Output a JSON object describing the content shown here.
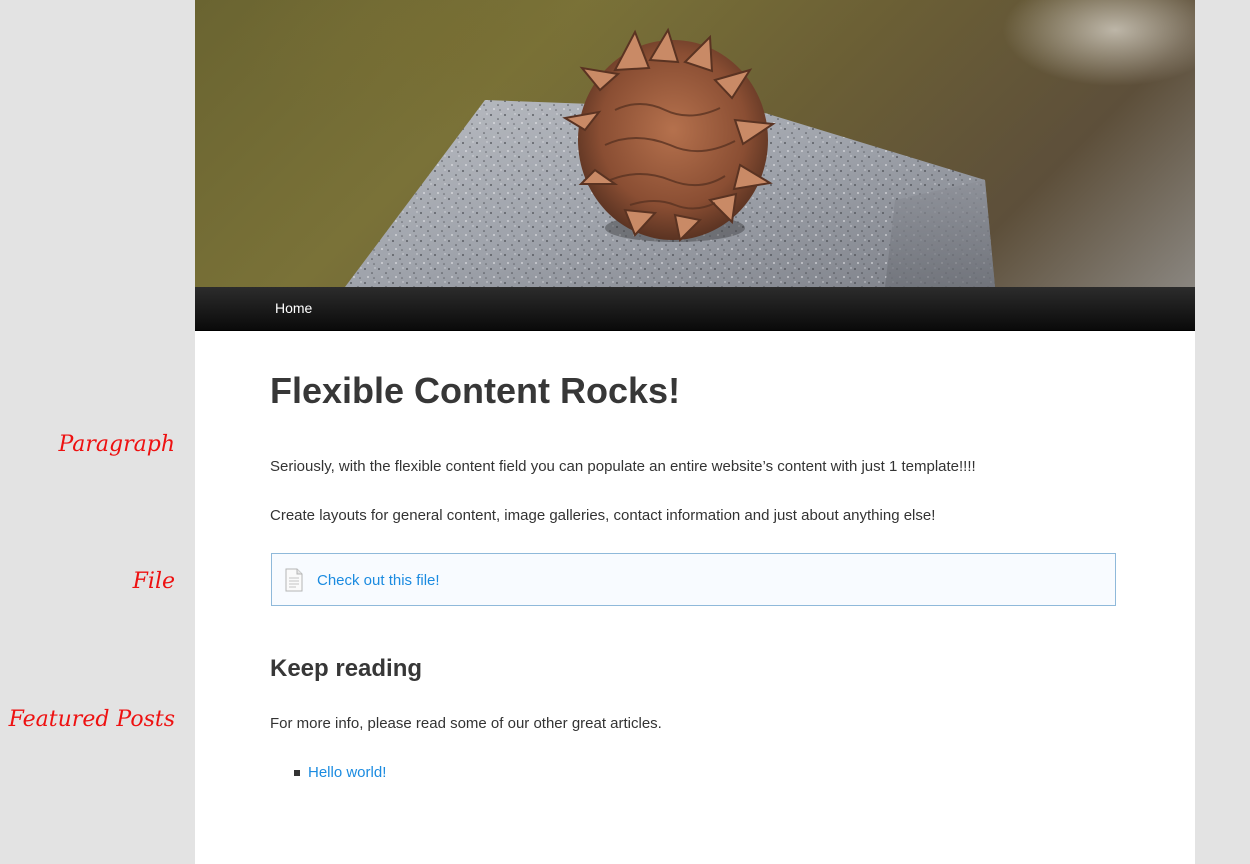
{
  "nav": {
    "home_label": "Home"
  },
  "main": {
    "title": "Flexible Content Rocks!",
    "paragraph_1": "Seriously, with the flexible content field you can populate an entire website’s content with just 1 template!!!!",
    "paragraph_2": "Create layouts for general content, image galleries, contact information and just about anything else!",
    "file": {
      "icon": "document-icon",
      "link_text": "Check out this file!"
    },
    "keep_reading": {
      "heading": "Keep reading",
      "intro": "For more info, please read some of our other great articles.",
      "posts": [
        {
          "label": "Hello world!"
        }
      ]
    }
  },
  "annotations": [
    {
      "label": "Paragraph"
    },
    {
      "label": "File"
    },
    {
      "label": "Featured Posts"
    }
  ],
  "colors": {
    "link": "#1b8be0",
    "annotation": "#ee1111",
    "navbar": "#111111",
    "file_border": "#8fb9da"
  }
}
